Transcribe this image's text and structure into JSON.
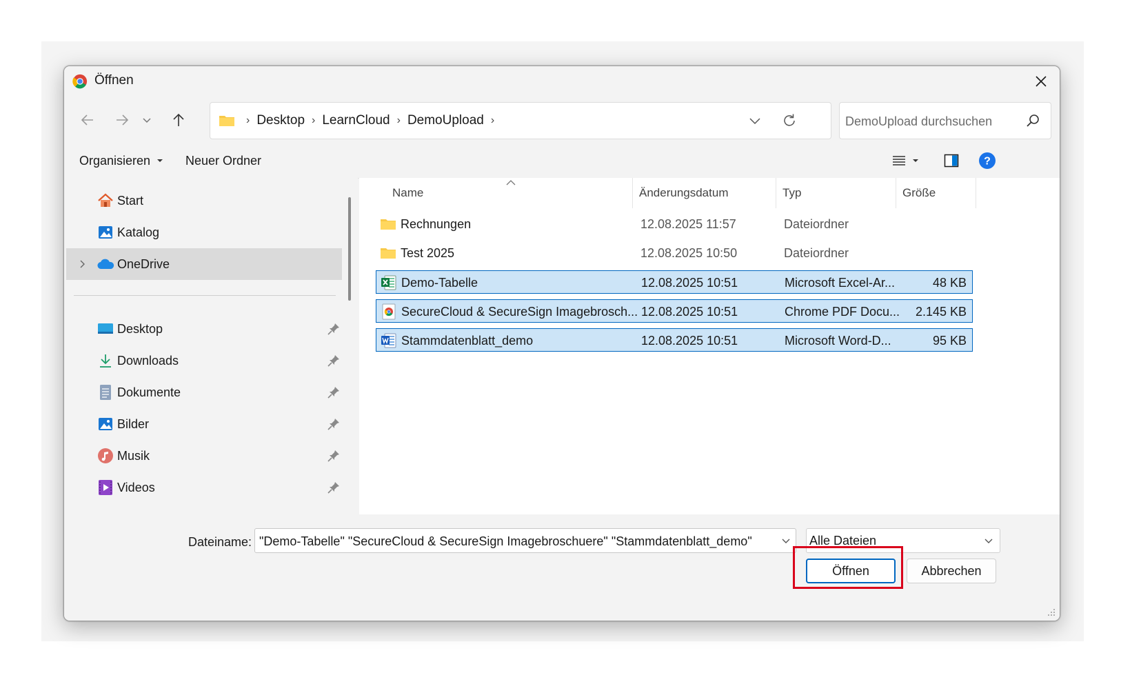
{
  "window": {
    "title": "Öffnen",
    "app_icon": "chrome-icon"
  },
  "address": {
    "crumbs": [
      "Desktop",
      "LearnCloud",
      "DemoUpload"
    ],
    "folder_icon": "folder-icon"
  },
  "search": {
    "placeholder": "DemoUpload durchsuchen"
  },
  "toolbar": {
    "organize_label": "Organisieren",
    "new_folder_label": "Neuer Ordner"
  },
  "sidebar": {
    "quick": [
      {
        "label": "Start",
        "icon": "home-icon"
      },
      {
        "label": "Katalog",
        "icon": "gallery-icon"
      },
      {
        "label": "OneDrive",
        "icon": "onedrive-icon"
      }
    ],
    "pinned": [
      {
        "label": "Desktop",
        "icon": "desktop-icon"
      },
      {
        "label": "Downloads",
        "icon": "download-icon"
      },
      {
        "label": "Dokumente",
        "icon": "document-icon"
      },
      {
        "label": "Bilder",
        "icon": "pictures-icon"
      },
      {
        "label": "Musik",
        "icon": "music-icon"
      },
      {
        "label": "Videos",
        "icon": "videos-icon"
      }
    ]
  },
  "columns": {
    "name": "Name",
    "date": "Änderungsdatum",
    "type": "Typ",
    "size": "Größe"
  },
  "files": [
    {
      "name": "Rechnungen",
      "date": "12.08.2025 11:57",
      "type": "Dateiordner",
      "size": "",
      "icon": "folder-icon",
      "selected": false
    },
    {
      "name": "Test 2025",
      "date": "12.08.2025 10:50",
      "type": "Dateiordner",
      "size": "",
      "icon": "folder-icon",
      "selected": false
    },
    {
      "name": "Demo-Tabelle",
      "date": "12.08.2025 10:51",
      "type": "Microsoft Excel-Ar...",
      "size": "48 KB",
      "icon": "excel-icon",
      "selected": true
    },
    {
      "name": "SecureCloud & SecureSign Imagebrosch...",
      "date": "12.08.2025 10:51",
      "type": "Chrome PDF Docu...",
      "size": "2.145 KB",
      "icon": "chrome-pdf-icon",
      "selected": true
    },
    {
      "name": "Stammdatenblatt_demo",
      "date": "12.08.2025 10:51",
      "type": "Microsoft Word-D...",
      "size": "95 KB",
      "icon": "word-icon",
      "selected": true
    }
  ],
  "footer": {
    "filename_label": "Dateiname:",
    "filename_value": "\"Demo-Tabelle\" \"SecureCloud & SecureSign Imagebroschuere\" \"Stammdatenblatt_demo\"",
    "filetype_value": "Alle Dateien",
    "open_label": "Öffnen",
    "cancel_label": "Abbrechen"
  },
  "colors": {
    "accent": "#0067c0",
    "selection": "#cce4f7",
    "highlight": "#d9001b"
  }
}
